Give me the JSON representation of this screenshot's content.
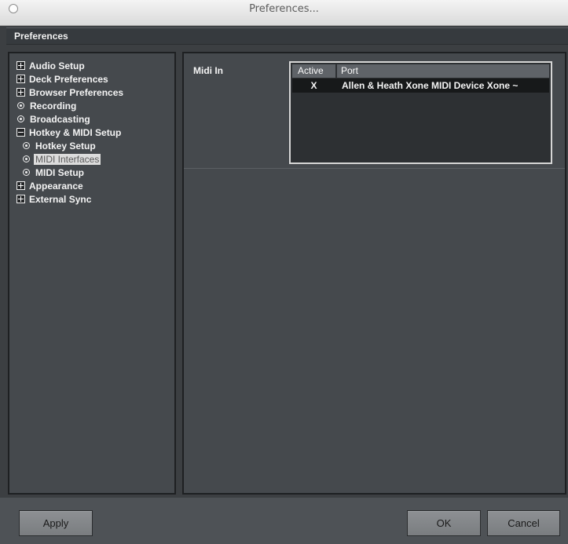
{
  "window": {
    "title": "Preferences..."
  },
  "header": {
    "title": "Preferences"
  },
  "tree": {
    "items": [
      {
        "label": "Audio Setup",
        "icon": "plus-box-icon"
      },
      {
        "label": "Deck Preferences",
        "icon": "plus-box-icon"
      },
      {
        "label": "Browser Preferences",
        "icon": "plus-box-icon"
      },
      {
        "label": "Recording",
        "icon": "radio-dot-icon"
      },
      {
        "label": "Broadcasting",
        "icon": "radio-dot-icon"
      },
      {
        "label": "Hotkey & MIDI Setup",
        "icon": "minus-box-icon"
      },
      {
        "label": "Hotkey Setup",
        "icon": "radio-dot-icon"
      },
      {
        "label": "MIDI Interfaces",
        "icon": "radio-dot-icon",
        "selected": true
      },
      {
        "label": "MIDI Setup",
        "icon": "radio-dot-icon"
      },
      {
        "label": "Appearance",
        "icon": "plus-box-icon"
      },
      {
        "label": "External Sync",
        "icon": "plus-box-icon"
      }
    ]
  },
  "midi_in": {
    "label": "Midi In",
    "columns": [
      "Active",
      "Port"
    ],
    "rows": [
      {
        "active": "X",
        "port": "Allen & Heath Xone MIDI Device Xone ~"
      }
    ]
  },
  "buttons": {
    "apply": "Apply",
    "ok": "OK",
    "cancel": "Cancel"
  }
}
